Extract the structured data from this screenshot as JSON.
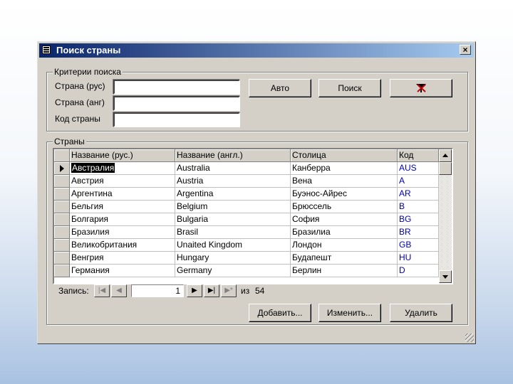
{
  "window": {
    "title": "Поиск страны",
    "close_icon": "×"
  },
  "criteria": {
    "group_label": "Критерии поиска",
    "country_ru_label": "Страна (рус)",
    "country_en_label": "Страна (анг)",
    "code_label": "Код страны",
    "country_ru_value": "",
    "country_en_value": "",
    "code_value": "",
    "auto_button": "Авто",
    "search_button": "Поиск",
    "clear_filter_icon": "filter-clear-icon"
  },
  "countries": {
    "group_label": "Страны",
    "columns": [
      "Название (рус.)",
      "Название (англ.)",
      "Столица",
      "Код"
    ],
    "rows": [
      [
        "Австралия",
        "Australia",
        "Канберра",
        "AUS"
      ],
      [
        "Австрия",
        "Austria",
        "Вена",
        "A"
      ],
      [
        "Аргентина",
        "Argentina",
        "Буэнос-Айрес",
        "AR"
      ],
      [
        "Бельгия",
        "Belgium",
        "Брюссель",
        "B"
      ],
      [
        "Болгария",
        "Bulgaria",
        "София",
        "BG"
      ],
      [
        "Бразилия",
        "Brasil",
        "Бразилиа",
        "BR"
      ],
      [
        "Великобритания",
        "Unaited Kingdom",
        "Лондон",
        "GB"
      ],
      [
        "Венгрия",
        "Hungary",
        "Будапешт",
        "HU"
      ],
      [
        "Германия",
        "Germany",
        "Берлин",
        "D"
      ]
    ]
  },
  "navigator": {
    "record_label": "Запись:",
    "current": "1",
    "of_label": "из",
    "total": "54",
    "first": "|◀",
    "prev": "◀",
    "next": "▶",
    "last": "▶|",
    "new": "▶*"
  },
  "actions": {
    "add_button": "Добавить...",
    "edit_button": "Изменить...",
    "delete_button": "Удалить"
  }
}
